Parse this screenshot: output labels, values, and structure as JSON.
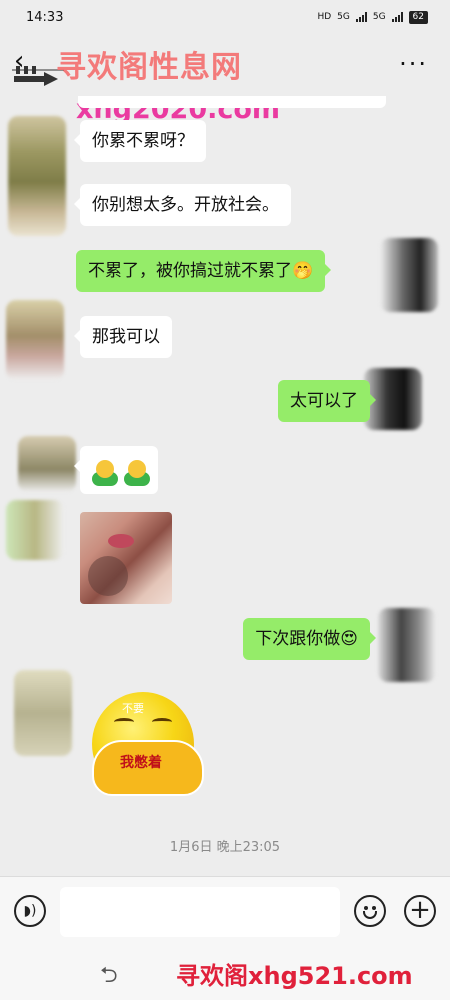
{
  "status_bar": {
    "time": "14:33",
    "hd": "HD",
    "net1": "5G",
    "net2": "5G",
    "battery": "62"
  },
  "header": {
    "back_glyph": "‹",
    "more_glyph": "···"
  },
  "watermarks": {
    "top_title": "寻欢阁性息网",
    "top_url": "xhg2020.com",
    "bottom": "寻欢阁xhg521.com"
  },
  "messages": [
    {
      "side": "left",
      "type": "text",
      "text": "你累不累呀？"
    },
    {
      "side": "left",
      "type": "text",
      "text": "你别想太多。开放社会。"
    },
    {
      "side": "right",
      "type": "text",
      "text": "不累了，被你搞过就不累了🤭"
    },
    {
      "side": "left",
      "type": "text",
      "text": "那我可以"
    },
    {
      "side": "right",
      "type": "text",
      "text": "太可以了"
    },
    {
      "side": "left",
      "type": "emoji",
      "icons": [
        "hug-icon",
        "hug-icon"
      ]
    },
    {
      "side": "left",
      "type": "image"
    },
    {
      "side": "right",
      "type": "text",
      "text": "下次跟你做😍"
    },
    {
      "side": "left",
      "type": "sticker",
      "top_text": "不要",
      "text": "我憋着"
    }
  ],
  "timestamp": "1月6日 晚上23:05",
  "input_bar": {
    "voice_icon": "voice-icon",
    "emoji_icon": "emoji-icon",
    "plus_icon": "plus-icon",
    "value": ""
  },
  "nav": {
    "back_glyph": "⮌"
  },
  "colors": {
    "sent_bubble": "#95ec69",
    "received_bubble": "#ffffff",
    "background": "#ededed",
    "watermark_top": "#f47474",
    "watermark_url": "#ea3aa0",
    "watermark_bottom": "#e0213b"
  }
}
